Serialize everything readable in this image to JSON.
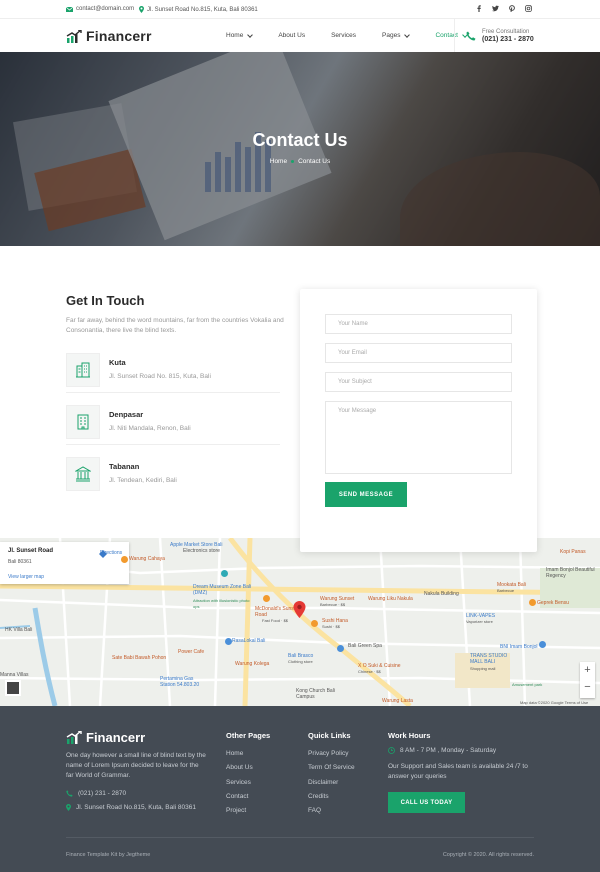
{
  "topbar": {
    "email": "contact@domain.com",
    "address": "Jl. Sunset Road No.815, Kuta, Bali 80361",
    "social": [
      "facebook-icon",
      "twitter-icon",
      "pinterest-icon",
      "instagram-icon"
    ]
  },
  "header": {
    "brand": "Financerr",
    "nav": [
      {
        "label": "Home",
        "dropdown": true
      },
      {
        "label": "About Us",
        "dropdown": false
      },
      {
        "label": "Services",
        "dropdown": false
      },
      {
        "label": "Pages",
        "dropdown": true
      },
      {
        "label": "Contact",
        "dropdown": true
      }
    ],
    "active_nav": "Contact",
    "consult_label": "Free Consultation",
    "consult_phone": "(021) 231 - 2870"
  },
  "hero": {
    "title": "Contact Us",
    "breadcrumb": [
      "Home",
      "Contact Us"
    ]
  },
  "contact": {
    "title": "Get In Touch",
    "description": "Far far away, behind the word mountains, far from the countries Vokalia and Consonantia, there live the blind texts.",
    "locations": [
      {
        "city": "Kuta",
        "street": "Jl. Sunset Road No. 815, Kuta, Bali",
        "icon": "building-icon"
      },
      {
        "city": "Denpasar",
        "street": "Jl. Niti Mandala, Renon, Bali",
        "icon": "office-icon"
      },
      {
        "city": "Tabanan",
        "street": "Jl. Tendean, Kediri, Bali",
        "icon": "bank-icon"
      }
    ]
  },
  "form": {
    "name_placeholder": "Your Name",
    "email_placeholder": "Your Email",
    "subject_placeholder": "Your Subject",
    "message_placeholder": "Your Message",
    "submit_label": "SEND MESSAGE"
  },
  "map": {
    "card_title": "Jl. Sunset Road",
    "card_subtitle": "Bali 80361",
    "card_link": "View larger map",
    "directions": "Directions",
    "attribution": "Map data ©2020 Google   Terms of Use",
    "labels": {
      "apple": "Apple Market Store Bali",
      "apple_sub": "Electronics store",
      "warung_cahaya": "Warung Cahaya",
      "museum": "Dream Museum Zone Bali (DMZ)",
      "museum_sub": "Attraction with illusionistic photo ops",
      "mcd": "McDonald's Sunset Road",
      "mcd_sub": "Fast Food · $$",
      "warung_sunset": "Warung Sunset",
      "warung_sunset_sub": "Barbecue · $$",
      "warung_liku": "Warung Liku Nakula",
      "nakula": "Nakula Building",
      "mookata": "Mookata Bali",
      "mookata_sub": "Barbecue",
      "imam": "Imam Bonjol Beautiful Regency",
      "kopi": "Kopi Panas",
      "sushi": "Sushi Hana",
      "sushi_sub": "Sushi · $$",
      "rasa": "RasaLokal Bali",
      "power": "Power Cafe",
      "sate": "Sate Babi Bawah Pohon",
      "warung_kolega": "Warung Kolega",
      "brasco": "Bali Brasco",
      "brasco_sub": "Clothing store",
      "green_spa": "Bali Green Spa",
      "xo": "X O Suki & Cuisine",
      "xo_sub": "Chinese · $$",
      "pertamina": "Pertamina Gas Station 54.803.20",
      "kong": "Kong Church Bali Campus",
      "link": "LINK-VAPES",
      "link_sub": "Vaporizer store",
      "trans": "TRANS STUDIO MALL BALI",
      "trans_sub": "Shopping mall",
      "bni": "BNI Imam Bonjol",
      "amusement": "Amusement park",
      "geprek": "Geprek Bensu",
      "hk": "HK Villa Bali",
      "manna": "Manna Villas",
      "lasta": "Warung Lasta"
    }
  },
  "footer": {
    "brand": "Financerr",
    "description": "One day however a small line of blind text by the name of Lorem Ipsum decided to leave for the far World of Grammar.",
    "phone": "(021) 231 - 2870",
    "address": "Jl. Sunset Road No.815, Kuta, Bali 80361",
    "other_pages_title": "Other Pages",
    "other_pages": [
      "Home",
      "About Us",
      "Services",
      "Contact",
      "Project"
    ],
    "quick_links_title": "Quick Links",
    "quick_links": [
      "Privacy Policy",
      "Term Of Service",
      "Disclaimer",
      "Credits",
      "FAQ"
    ],
    "work_hours_title": "Work Hours",
    "hours": "8 AM - 7 PM , Monday - Saturday",
    "support": "Our Support and Sales team is available 24 /7 to answer your queries",
    "call_label": "CALL US TODAY",
    "kit": "Finance Template Kit by Jegtheme",
    "copyright": "Copyright © 2020. All rights reserved."
  },
  "colors": {
    "accent": "#1aa36b",
    "footer_bg": "#444b54",
    "map_pin": "#e53935"
  }
}
